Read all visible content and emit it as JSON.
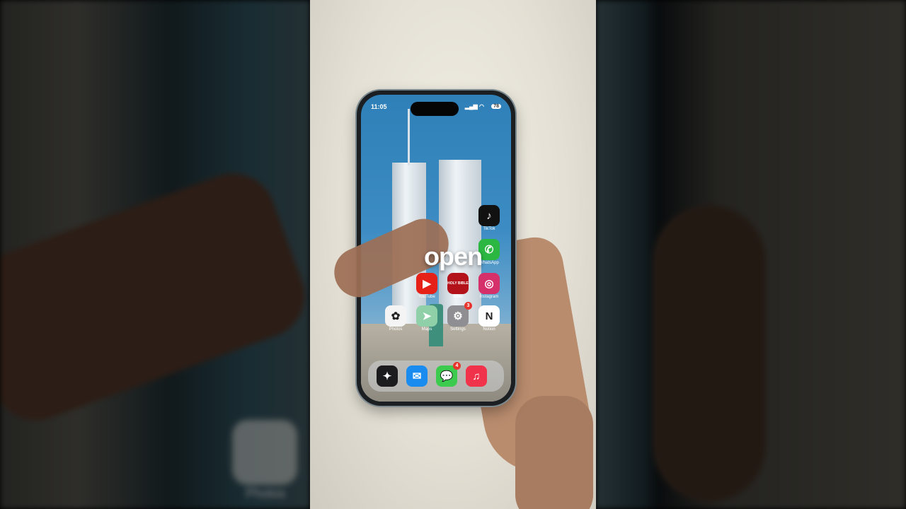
{
  "caption": "open",
  "status_bar": {
    "time": "11:05",
    "battery": "78"
  },
  "home_apps": [
    {
      "label": "TikTok",
      "icon": "tiktok-icon",
      "color": "#111111",
      "glyph": "♪",
      "badge": ""
    },
    {
      "label": "WhatsApp",
      "icon": "whatsapp-icon",
      "color": "#2bb741",
      "glyph": "✆",
      "badge": ""
    },
    {
      "label": "YouTube",
      "icon": "youtube-icon",
      "color": "#e62117",
      "glyph": "▶",
      "badge": ""
    },
    {
      "label": "Bible",
      "icon": "holy-bible-icon",
      "color": "#b3121a",
      "glyph": "HOLY BIBLE",
      "badge": ""
    },
    {
      "label": "Instagram",
      "icon": "instagram-icon",
      "color": "#d6306b",
      "glyph": "◎",
      "badge": ""
    },
    {
      "label": "Photos",
      "icon": "photos-icon",
      "color": "#f4f4f4",
      "glyph": "✿",
      "badge": ""
    },
    {
      "label": "Maps",
      "icon": "maps-icon",
      "color": "#8fd0a8",
      "glyph": "➤",
      "badge": ""
    },
    {
      "label": "Settings",
      "icon": "settings-gear-icon",
      "color": "#8e8e93",
      "glyph": "⚙",
      "badge": "3"
    },
    {
      "label": "Notion",
      "icon": "notion-icon",
      "color": "#ffffff",
      "glyph": "N",
      "badge": ""
    }
  ],
  "dock_apps": [
    {
      "icon": "shortcuts-icon",
      "color": "#1c1c1e",
      "glyph": "✦",
      "badge": ""
    },
    {
      "icon": "mail-icon",
      "color": "#1a8cf0",
      "glyph": "✉",
      "badge": ""
    },
    {
      "icon": "messages-icon",
      "color": "#3ccb4e",
      "glyph": "💬",
      "badge": "4"
    },
    {
      "icon": "music-icon",
      "color": "#f0324a",
      "glyph": "♫",
      "badge": ""
    }
  ],
  "background_blur_label": "Photos"
}
